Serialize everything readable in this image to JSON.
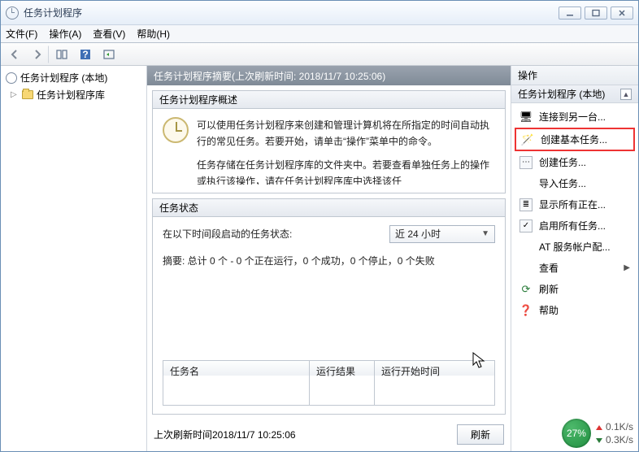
{
  "window": {
    "title": "任务计划程序"
  },
  "menu": {
    "file": "文件(F)",
    "action": "操作(A)",
    "view": "查看(V)",
    "help": "帮助(H)"
  },
  "tree": {
    "root": "任务计划程序 (本地)",
    "library": "任务计划程序库"
  },
  "center": {
    "header": "任务计划程序摘要(上次刷新时间: 2018/11/7 10:25:06)",
    "overview": {
      "title": "任务计划程序概述",
      "p1": "可以使用任务计划程序来创建和管理计算机将在所指定的时间自动执行的常见任务。若要开始，请单击“操作”菜单中的命令。",
      "p2": "任务存储在任务计划程序库的文件夹中。若要查看单独任务上的操作或执行该操作，请在任务计划程序库中选择该任"
    },
    "status": {
      "title": "任务状态",
      "range_label": "在以下时间段启动的任务状态:",
      "range_value": "近 24 小时",
      "summary": "摘要: 总计 0 个 - 0 个正在运行，0 个成功，0 个停止，0 个失败",
      "columns": {
        "name": "任务名",
        "result": "运行结果",
        "start": "运行开始时间"
      }
    },
    "footer": {
      "last_refresh": "上次刷新时间2018/11/7 10:25:06",
      "refresh_btn": "刷新"
    }
  },
  "actions": {
    "pane_title": "操作",
    "section_title": "任务计划程序 (本地)",
    "items": {
      "connect": "连接到另一台...",
      "create_basic": "创建基本任务...",
      "create_task": "创建任务...",
      "import": "导入任务...",
      "show_running": "显示所有正在...",
      "enable_history": "启用所有任务...",
      "at_service": "AT 服务帐户配...",
      "view": "查看",
      "refresh": "刷新",
      "help": "帮助"
    }
  },
  "net": {
    "pct": "27%",
    "up": "0.1K/s",
    "down": "0.3K/s"
  }
}
